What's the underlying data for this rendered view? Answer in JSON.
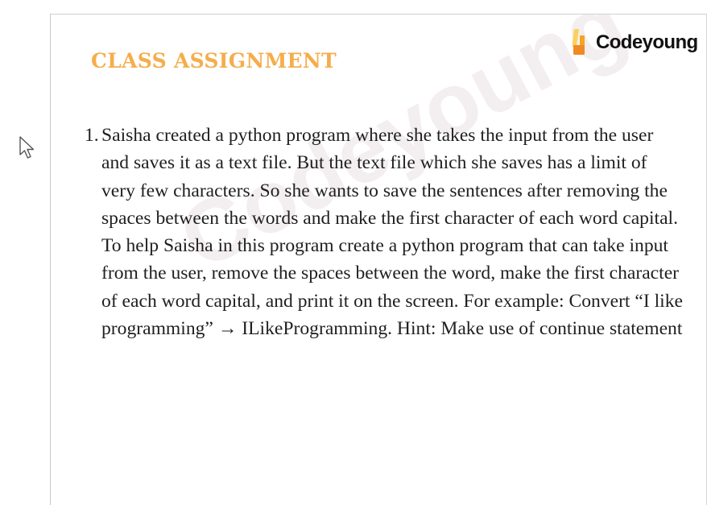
{
  "slide": {
    "logo": {
      "text": "Codeyoung",
      "colors": {
        "bar_dark": "#f5a524",
        "bar_light": "#fbd15b",
        "square": "#f08a24"
      }
    },
    "title": "CLASS ASSIGNMENT",
    "title_color": "#f5ad4c",
    "watermark": "Codeyoung",
    "question": {
      "number": "1.",
      "text": "Saisha created a python program where she takes the input from the user and saves it as a text file. But the text file which she saves has a limit of very few characters. So she wants to save the sentences after removing the spaces between the words and make the first character of each word capital. To help Saisha in this program create a python program that can take input from the user, remove the spaces between the word, make the first character of each word capital, and print it on the screen.  For example: Convert “I like programming” → ILikeProgramming. Hint: Make use of continue statement"
    }
  },
  "cursor": {
    "icon": "mouse-pointer-icon"
  }
}
